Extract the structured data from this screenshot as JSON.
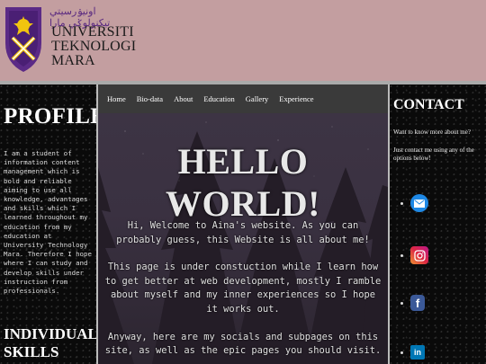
{
  "header": {
    "logo_arabic": "اونيۏرسيتي تيكنولوݢي مارا",
    "logo_name": [
      "UNIVERSITI",
      "TEKNOLOGI",
      "MARA"
    ]
  },
  "nav": {
    "items": [
      "Home",
      "Bio-data",
      "About",
      "Education",
      "Gallery",
      "Experience"
    ]
  },
  "profile": {
    "title": "PROFILE",
    "text": "I am a student of information content management which is bold and reliable aiming to use all knowledge, advantages and skills which I learned throughout my education from my education at University Technology Mara. Therefore I hope where I can study and develop skills under instruction from professionals.",
    "skills_title": "INDIVIDUAL SKILLS"
  },
  "hero": {
    "title": "HELLO WORLD!",
    "paragraphs": [
      "Hi, Welcome to Aina's website. As you can probably guess, this Website is all about me!",
      "This page is under constuction while I learn how to get better at web development, mostly I ramble about myself and my inner experiences so I hope it works out.",
      "Anyway, here are my socials and subpages on this site, as well as the epic pages you should visit."
    ]
  },
  "contact": {
    "title": "CONTACT",
    "line1": "Want to know more about me?",
    "line2": "Just contact me using any of the options below!",
    "socials": [
      {
        "name": "mail-icon",
        "color": "#ffffff"
      },
      {
        "name": "instagram-icon",
        "color": "#d6249f"
      },
      {
        "name": "facebook-icon",
        "color": "#3b5998"
      },
      {
        "name": "linkedin-icon",
        "color": "#0077b5"
      }
    ]
  }
}
